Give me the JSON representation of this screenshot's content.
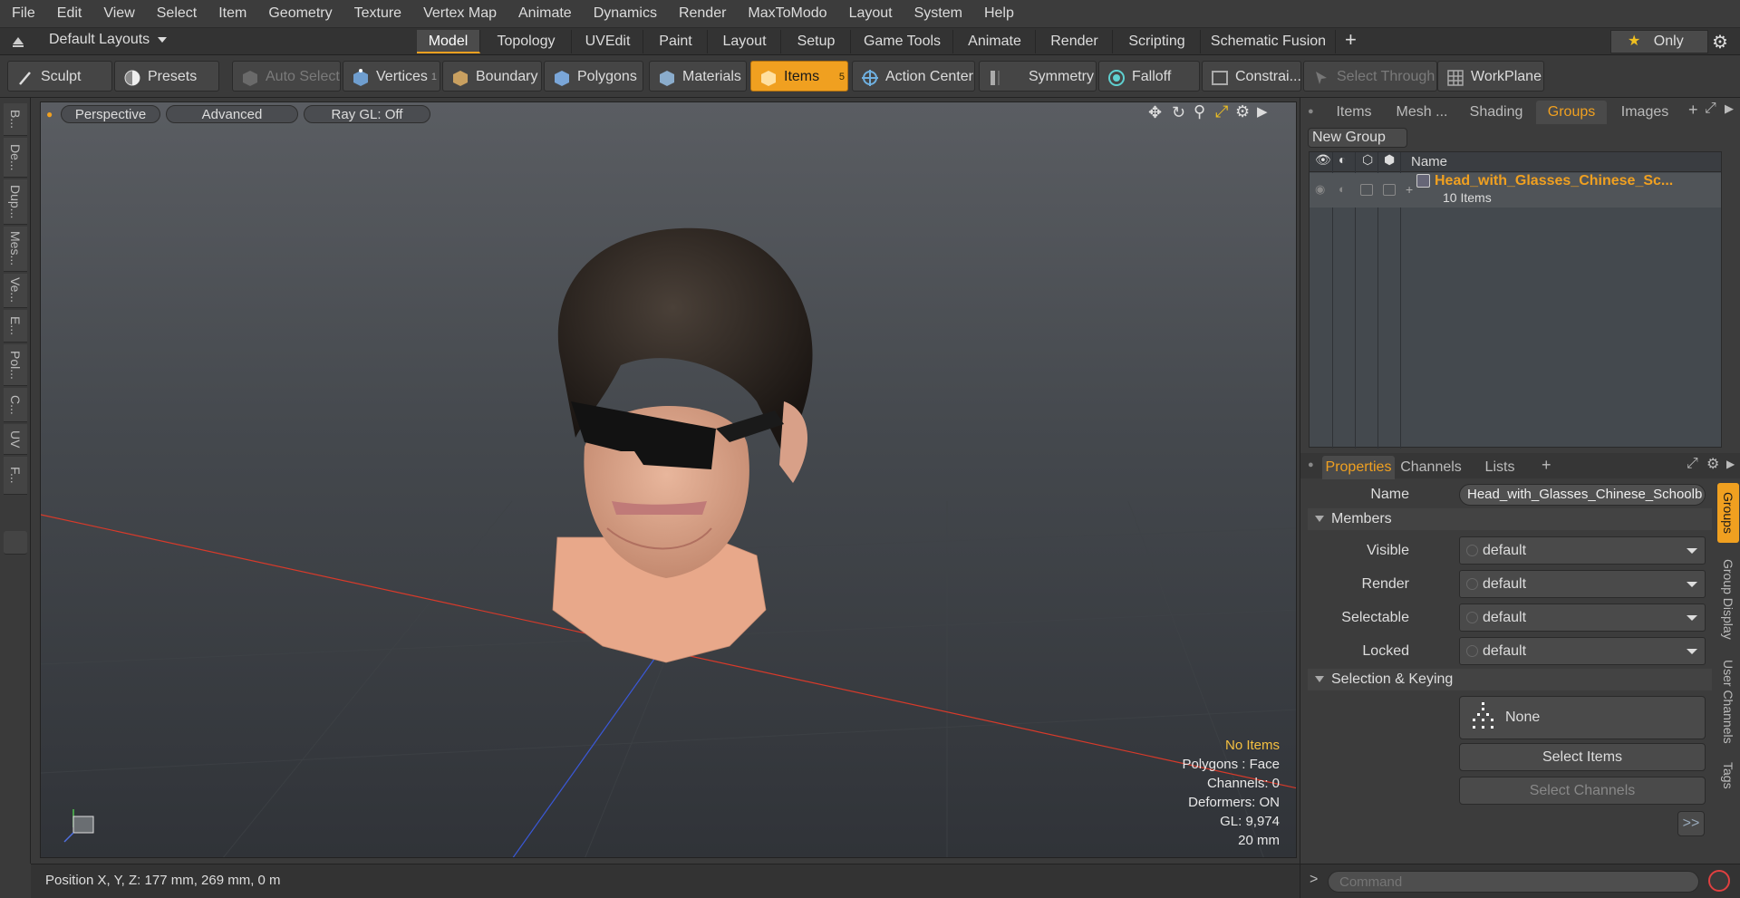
{
  "menu": [
    "File",
    "Edit",
    "View",
    "Select",
    "Item",
    "Geometry",
    "Texture",
    "Vertex Map",
    "Animate",
    "Dynamics",
    "Render",
    "MaxToModo",
    "Layout",
    "System",
    "Help"
  ],
  "layoutbar": {
    "layout_name": "Default Layouts",
    "tabs": [
      "Model",
      "Topology",
      "UVEdit",
      "Paint",
      "Layout",
      "Setup",
      "Game Tools",
      "Animate",
      "Render",
      "Scripting",
      "Schematic Fusion"
    ],
    "active_tab": "Model",
    "add_label": "+",
    "only_label": "Only"
  },
  "toolbar": {
    "sculpt": "Sculpt",
    "presets": "Presets",
    "auto_select": "Auto Select",
    "vertices": "Vertices",
    "vertices_count": "1",
    "boundary": "Boundary",
    "polygons": "Polygons",
    "materials": "Materials",
    "items": "Items",
    "items_count": "5",
    "action_center": "Action Center",
    "symmetry": "Symmetry",
    "falloff": "Falloff",
    "constraints": "Constrai...",
    "select_through": "Select Through",
    "workplane": "WorkPlane"
  },
  "left_tabs": [
    "B...",
    "De...",
    "Dup...",
    "Mes...",
    "Ve...",
    "E...",
    "Pol...",
    "C...",
    "UV",
    "F..."
  ],
  "viewport": {
    "view": "Perspective",
    "shading": "Advanced",
    "raygl": "Ray GL: Off",
    "info": {
      "selection": "No Items",
      "polygons": "Polygons : Face",
      "channels": "Channels: 0",
      "deformers": "Deformers: ON",
      "gl": "GL: 9,974",
      "scale": "20 mm"
    },
    "axis_y": "Y",
    "axis_x": "X",
    "axis_z": "Z"
  },
  "status": {
    "position": "Position X, Y, Z:   177 mm, 269 mm, 0 m"
  },
  "groups_panel": {
    "tabs": [
      "Items",
      "Mesh ...",
      "Shading",
      "Groups",
      "Images"
    ],
    "active_tab": "Groups",
    "new_group": "New Group",
    "col_name": "Name",
    "group_name": "Head_with_Glasses_Chinese_Sc...",
    "group_count": "10 Items"
  },
  "properties": {
    "tabs": [
      "Properties",
      "Channels",
      "Lists"
    ],
    "name_label": "Name",
    "name_value": "Head_with_Glasses_Chinese_Schoolb",
    "members_section": "Members",
    "fields": [
      {
        "label": "Visible",
        "value": "default"
      },
      {
        "label": "Render",
        "value": "default"
      },
      {
        "label": "Selectable",
        "value": "default"
      },
      {
        "label": "Locked",
        "value": "default"
      }
    ],
    "selkey_section": "Selection & Keying",
    "none_label": "None",
    "select_items": "Select Items",
    "select_channels": "Select Channels",
    "more": ">>",
    "side_tabs": [
      "Groups",
      "Group Display",
      "User Channels",
      "Tags"
    ]
  },
  "command": {
    "placeholder": "Command",
    "prompt": ">"
  },
  "colors": {
    "accent": "#f0a020",
    "x_axis": "#d83a2a",
    "z_axis": "#3a58d8"
  }
}
